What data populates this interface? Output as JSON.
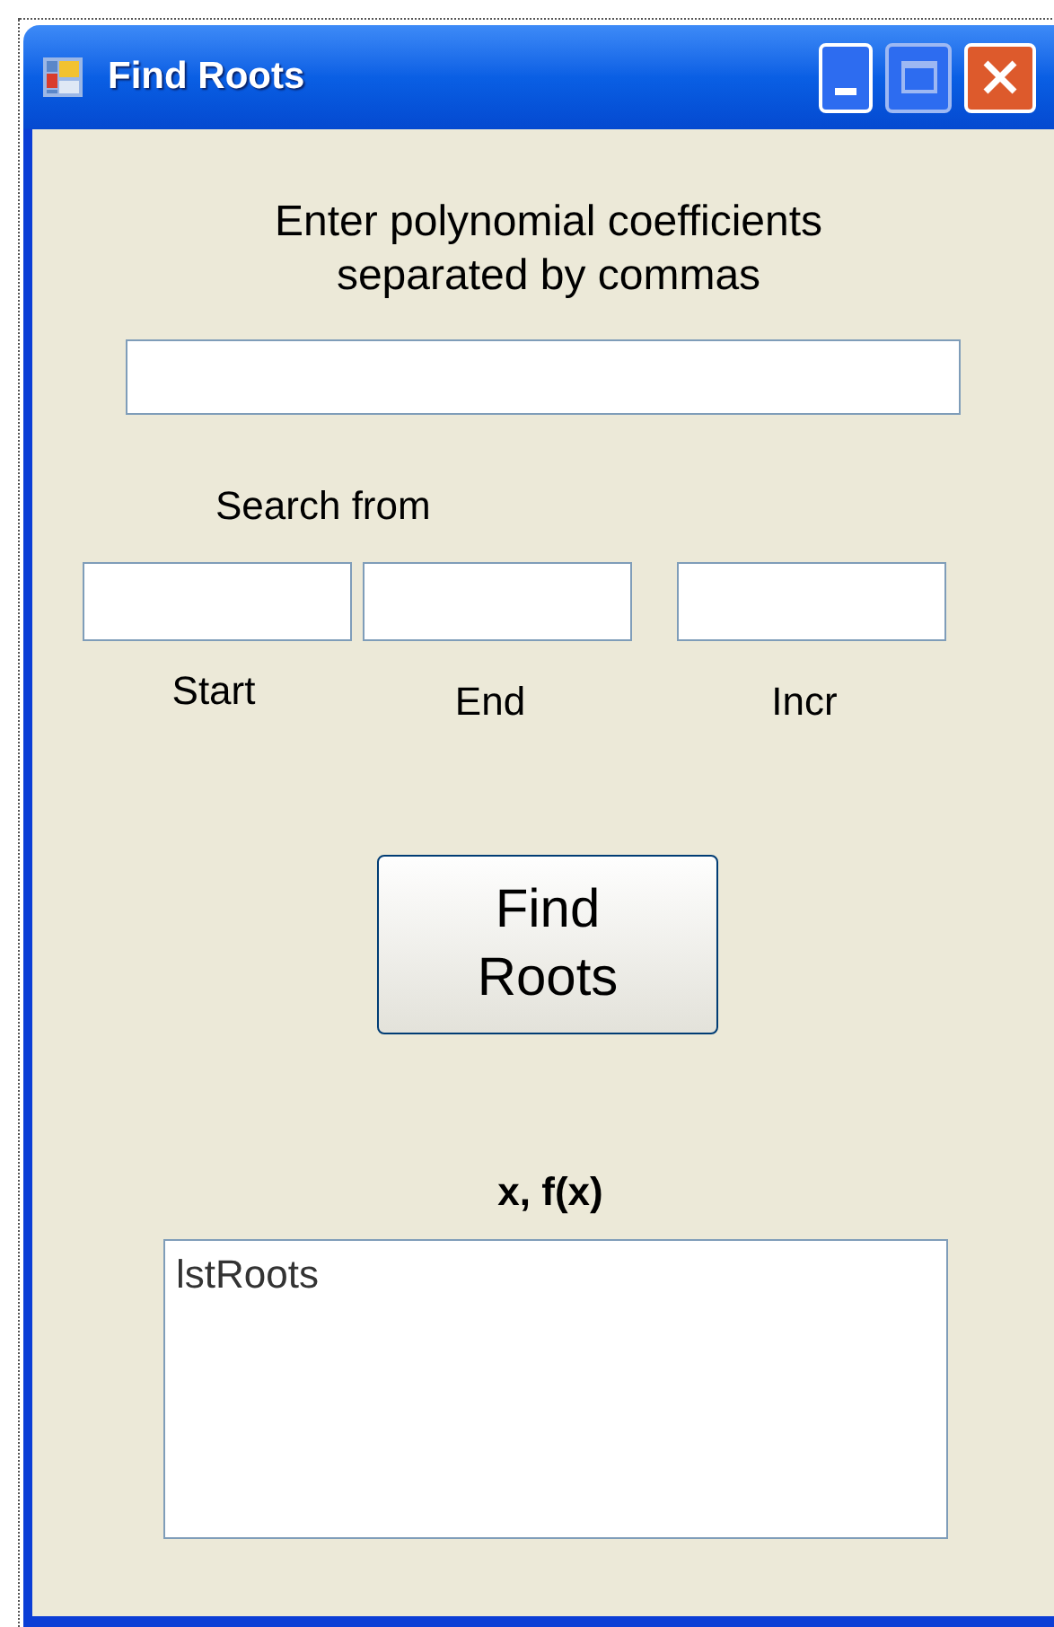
{
  "window": {
    "title": "Find Roots"
  },
  "prompt": "Enter polynomial coefficients separated by commas",
  "search_label": "Search from",
  "range_fields": [
    {
      "label": "Start"
    },
    {
      "label": "End"
    },
    {
      "label": "Incr"
    }
  ],
  "find_button": "Find Roots",
  "results": {
    "header": "x, f(x)",
    "items": [
      "lstRoots"
    ]
  }
}
